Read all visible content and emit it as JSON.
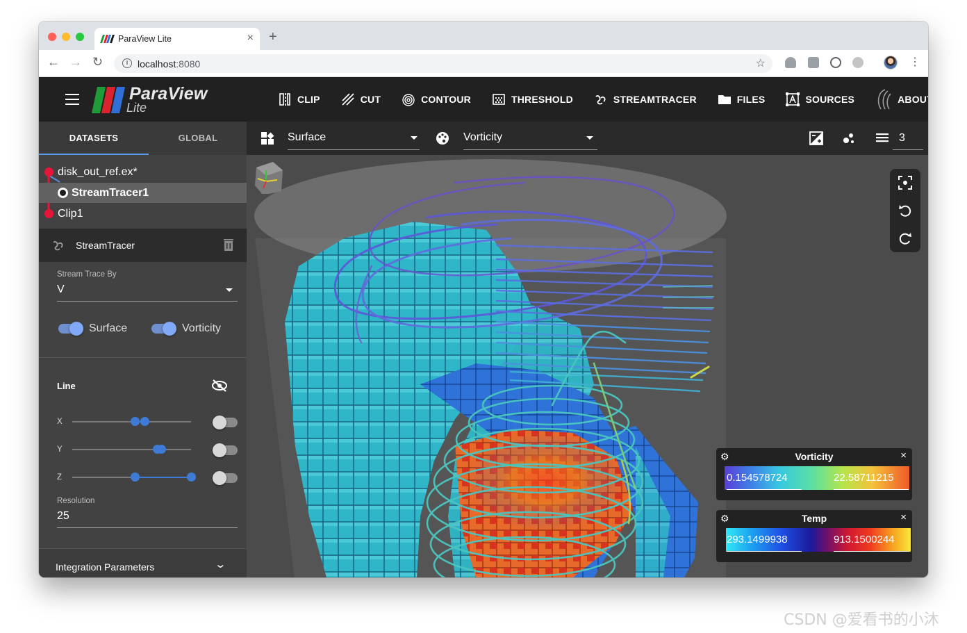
{
  "browser": {
    "tab_title": "ParaView Lite",
    "tab_close": "×",
    "new_tab": "+",
    "url_host": "localhost",
    "url_port": ":8080"
  },
  "app": {
    "logo_main": "ParaView",
    "logo_sub": "Lite",
    "logo_colors": [
      "#1f9b3a",
      "#d9232e",
      "#2f6fd6"
    ],
    "menu": [
      {
        "label": "CLIP",
        "icon": "clip-icon"
      },
      {
        "label": "CUT",
        "icon": "cut-icon"
      },
      {
        "label": "CONTOUR",
        "icon": "contour-icon"
      },
      {
        "label": "THRESHOLD",
        "icon": "threshold-icon"
      },
      {
        "label": "STREAMTRACER",
        "icon": "streamtracer-icon"
      },
      {
        "label": "FILES",
        "icon": "folder-icon"
      },
      {
        "label": "SOURCES",
        "icon": "sources-icon"
      },
      {
        "label": "ABOUT",
        "icon": "about-icon"
      }
    ]
  },
  "sidebar": {
    "tabs": {
      "datasets": "DATASETS",
      "global": "GLOBAL"
    },
    "pipeline": [
      "disk_out_ref.ex*",
      "StreamTracer1",
      "Clip1"
    ],
    "panel_title": "StreamTracer",
    "stream_trace_by_label": "Stream Trace By",
    "stream_trace_by_value": "V",
    "toggles": {
      "surface": "Surface",
      "vorticity": "Vorticity"
    },
    "line_title": "Line",
    "axes": [
      "X",
      "Y",
      "Z"
    ],
    "resolution_label": "Resolution",
    "resolution_value": "25",
    "integration_label": "Integration Parameters"
  },
  "view_toolbar": {
    "representation": "Surface",
    "color_by": "Vorticity",
    "count": "3"
  },
  "colormaps": {
    "vorticity": {
      "title": "Vorticity",
      "min": "0.154578724",
      "max": "22.58711215"
    },
    "temp": {
      "title": "Temp",
      "min": "293.1499938",
      "max": "913.1500244"
    }
  },
  "colors": {
    "accent": "#5b9be6",
    "pipeline_dot": "#e8153a",
    "header_bg": "#212121",
    "panel_bg": "#424242"
  },
  "watermark": "CSDN @爱看书的小沐"
}
